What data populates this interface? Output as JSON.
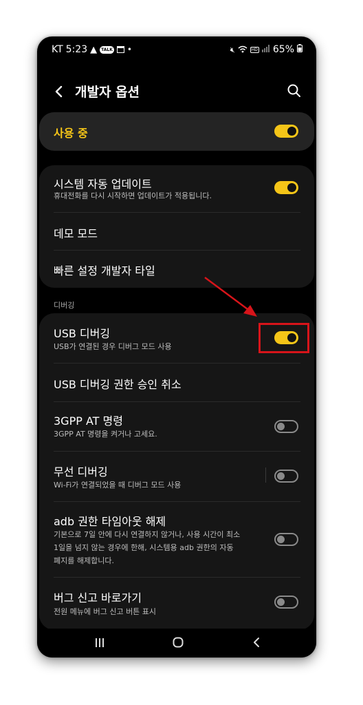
{
  "status_bar": {
    "carrier": "KT",
    "time": "5:23",
    "talk_badge": "TALK",
    "dot": "•",
    "battery": "65%"
  },
  "header": {
    "title": "개발자 옵션"
  },
  "main_switch": {
    "label": "사용 중",
    "enabled": true
  },
  "general": [
    {
      "title": "시스템 자동 업데이트",
      "subtitle": "휴대전화를 다시 시작하면 업데이트가 적용됩니다.",
      "toggle": "on"
    },
    {
      "title": "데모 모드"
    },
    {
      "title": "빠른 설정 개발자 타일"
    }
  ],
  "debugging_section": {
    "label": "디버깅",
    "items": [
      {
        "title": "USB 디버깅",
        "subtitle": "USB가 연결된 경우 디버그 모드 사용",
        "toggle": "on"
      },
      {
        "title": "USB 디버깅 권한 승인 취소"
      },
      {
        "title": "3GPP AT 명령",
        "subtitle": "3GPP AT 명령을 켜거나 고세요.",
        "toggle": "off"
      },
      {
        "title": "무선 디버깅",
        "subtitle": "Wi-Fi가 연결되었을 때 디버그 모드 사용",
        "toggle": "off"
      },
      {
        "title": "adb 권한 타임아웃 해제",
        "subtitle_lines": [
          "기본으로 7일 안에 다시 연결하지 않거나, 사용 시간이 최소",
          "1일을 넘지 않는 경우에 한해, 시스템용 adb 권한의 자동",
          "폐지를 해제합니다."
        ],
        "toggle": "off"
      },
      {
        "title": "버그 신고 바로가기",
        "subtitle": "전원 메뉴에 버그 신고 버튼 표시",
        "toggle": "off"
      }
    ]
  },
  "colors": {
    "accent": "#f5c518",
    "annotation": "#d7141a",
    "card": "#161616"
  },
  "icons": [
    "back-icon",
    "search-icon",
    "recents-icon",
    "home-icon",
    "nav-back-icon"
  ]
}
